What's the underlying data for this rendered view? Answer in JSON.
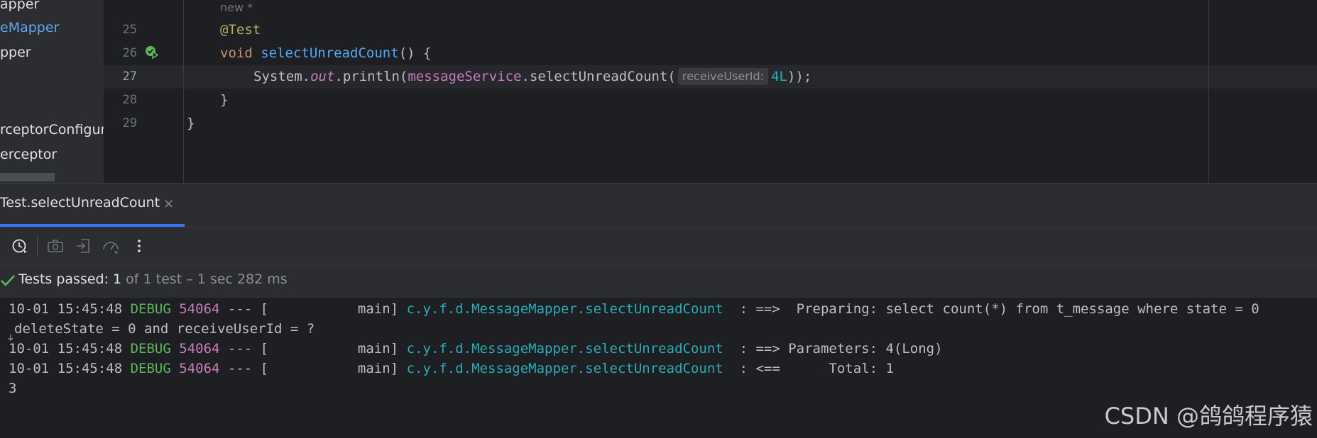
{
  "sidebar": {
    "items": [
      {
        "label": "apper",
        "selected": false
      },
      {
        "label": "eMapper",
        "selected": true
      },
      {
        "label": "pper",
        "selected": false
      },
      {
        "label": "rceptorConfigure",
        "selected": false
      },
      {
        "label": "erceptor",
        "selected": false
      }
    ]
  },
  "editor": {
    "inlay_author": "new *",
    "lines": [
      {
        "num": "25"
      },
      {
        "num": "26"
      },
      {
        "num": "27"
      },
      {
        "num": "28"
      },
      {
        "num": "29"
      }
    ],
    "code": {
      "annotation": "@Test",
      "void_kw": "void",
      "method_name": "selectUnreadCount",
      "method_tail": "() {",
      "sys": "System.",
      "out": "out",
      "println": ".println(",
      "service_field": "messageService",
      "call": ".selectUnreadCount(",
      "param_hint": "receiveUserId:",
      "arg": "4L",
      "call_end": "));",
      "close_method": "}",
      "close_class": "}"
    }
  },
  "run_tab": {
    "label": "Test.selectUnreadCount",
    "close_glyph": "×"
  },
  "toolbar": {
    "icons": [
      "history-icon",
      "camera-icon",
      "import-icon",
      "coverage-icon",
      "more-icon"
    ]
  },
  "status": {
    "passed_label": "Tests passed: 1",
    "detail": " of 1 test – 1 sec 282 ms"
  },
  "console": {
    "lines": [
      {
        "ts": "10-01 15:45:48",
        "level": "DEBUG",
        "pid": "54064",
        "sep": " --- [           main] ",
        "logger": "c.y.f.d.MessageMapper.selectUnreadCount",
        "msg": "  : ==>  Preparing: select count(*) from t_message where state = 0"
      },
      {
        "text": "deleteState = 0 and receiveUserId = ?"
      },
      {
        "ts": "10-01 15:45:48",
        "level": "DEBUG",
        "pid": "54064",
        "sep": " --- [           main] ",
        "logger": "c.y.f.d.MessageMapper.selectUnreadCount",
        "msg": "  : ==> Parameters: 4(Long)"
      },
      {
        "ts": "10-01 15:45:48",
        "level": "DEBUG",
        "pid": "54064",
        "sep": " --- [           main] ",
        "logger": "c.y.f.d.MessageMapper.selectUnreadCount",
        "msg": "  : <==      Total: 1"
      },
      {
        "text": "3"
      }
    ]
  },
  "watermark": "CSDN @鸽鸽程序猿",
  "colors": {
    "accent": "#3574f0",
    "success": "#5fb65f",
    "keyword": "#cf8e6d",
    "function": "#56a8f5",
    "number": "#2aacb8",
    "field": "#c77dbb"
  }
}
